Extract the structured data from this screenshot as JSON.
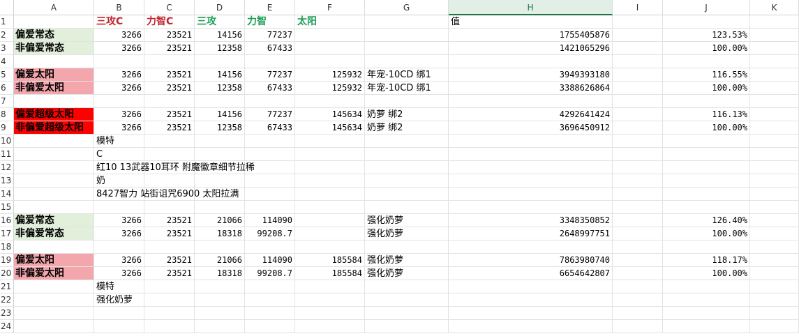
{
  "colors": {
    "green_fill": "#e2efda",
    "pink_fill": "#f4a6ad",
    "red_fill": "#ff0000",
    "header_red": "#c0262d",
    "header_green": "#1f9d55",
    "selected_col": "#217346"
  },
  "columns": [
    "A",
    "B",
    "C",
    "D",
    "E",
    "F",
    "G",
    "H",
    "I",
    "J",
    "K"
  ],
  "selected_column": "H",
  "rows": [
    "1",
    "2",
    "3",
    "4",
    "5",
    "6",
    "7",
    "8",
    "9",
    "10",
    "11",
    "12",
    "13",
    "14",
    "15",
    "16",
    "17",
    "18",
    "19",
    "20",
    "21",
    "22",
    "23",
    "24"
  ],
  "cells": [
    {
      "r": 1,
      "c": "B",
      "v": "三攻C",
      "style": "hdr-red"
    },
    {
      "r": 1,
      "c": "C",
      "v": "力智C",
      "style": "hdr-red"
    },
    {
      "r": 1,
      "c": "D",
      "v": "三攻",
      "style": "hdr-green"
    },
    {
      "r": 1,
      "c": "E",
      "v": "力智",
      "style": "hdr-green"
    },
    {
      "r": 1,
      "c": "F",
      "v": "太阳",
      "style": "hdr-green"
    },
    {
      "r": 1,
      "c": "H",
      "v": "值",
      "style": "txt"
    },
    {
      "r": 2,
      "c": "A",
      "v": "偏爱常态",
      "style": "lbl",
      "fill": "green_fill"
    },
    {
      "r": 2,
      "c": "B",
      "v": "3266",
      "style": "num"
    },
    {
      "r": 2,
      "c": "C",
      "v": "23521",
      "style": "num"
    },
    {
      "r": 2,
      "c": "D",
      "v": "14156",
      "style": "num"
    },
    {
      "r": 2,
      "c": "E",
      "v": "77237",
      "style": "num"
    },
    {
      "r": 2,
      "c": "H",
      "v": "1755405876",
      "style": "num"
    },
    {
      "r": 2,
      "c": "J",
      "v": "123.53%",
      "style": "num"
    },
    {
      "r": 3,
      "c": "A",
      "v": "非偏爱常态",
      "style": "lbl",
      "fill": "green_fill"
    },
    {
      "r": 3,
      "c": "B",
      "v": "3266",
      "style": "num"
    },
    {
      "r": 3,
      "c": "C",
      "v": "23521",
      "style": "num"
    },
    {
      "r": 3,
      "c": "D",
      "v": "12358",
      "style": "num"
    },
    {
      "r": 3,
      "c": "E",
      "v": "67433",
      "style": "num"
    },
    {
      "r": 3,
      "c": "H",
      "v": "1421065296",
      "style": "num"
    },
    {
      "r": 3,
      "c": "J",
      "v": "100.00%",
      "style": "num"
    },
    {
      "r": 5,
      "c": "A",
      "v": "偏爱太阳",
      "style": "lbl",
      "fill": "pink_fill"
    },
    {
      "r": 5,
      "c": "B",
      "v": "3266",
      "style": "num"
    },
    {
      "r": 5,
      "c": "C",
      "v": "23521",
      "style": "num"
    },
    {
      "r": 5,
      "c": "D",
      "v": "14156",
      "style": "num"
    },
    {
      "r": 5,
      "c": "E",
      "v": "77237",
      "style": "num"
    },
    {
      "r": 5,
      "c": "F",
      "v": "125932",
      "style": "num"
    },
    {
      "r": 5,
      "c": "G",
      "v": "年宠-10CD 绑1",
      "style": "txt"
    },
    {
      "r": 5,
      "c": "H",
      "v": "3949393180",
      "style": "num"
    },
    {
      "r": 5,
      "c": "J",
      "v": "116.55%",
      "style": "num"
    },
    {
      "r": 6,
      "c": "A",
      "v": "非偏爱太阳",
      "style": "lbl",
      "fill": "pink_fill"
    },
    {
      "r": 6,
      "c": "B",
      "v": "3266",
      "style": "num"
    },
    {
      "r": 6,
      "c": "C",
      "v": "23521",
      "style": "num"
    },
    {
      "r": 6,
      "c": "D",
      "v": "12358",
      "style": "num"
    },
    {
      "r": 6,
      "c": "E",
      "v": "67433",
      "style": "num"
    },
    {
      "r": 6,
      "c": "F",
      "v": "125932",
      "style": "num"
    },
    {
      "r": 6,
      "c": "G",
      "v": "年宠-10CD 绑1",
      "style": "txt"
    },
    {
      "r": 6,
      "c": "H",
      "v": "3388626864",
      "style": "num"
    },
    {
      "r": 6,
      "c": "J",
      "v": "100.00%",
      "style": "num"
    },
    {
      "r": 8,
      "c": "A",
      "v": "偏爱超级太阳",
      "style": "lbl",
      "fill": "red_fill"
    },
    {
      "r": 8,
      "c": "B",
      "v": "3266",
      "style": "num"
    },
    {
      "r": 8,
      "c": "C",
      "v": "23521",
      "style": "num"
    },
    {
      "r": 8,
      "c": "D",
      "v": "14156",
      "style": "num"
    },
    {
      "r": 8,
      "c": "E",
      "v": "77237",
      "style": "num"
    },
    {
      "r": 8,
      "c": "F",
      "v": "145634",
      "style": "num"
    },
    {
      "r": 8,
      "c": "G",
      "v": "奶萝 绑2",
      "style": "txt"
    },
    {
      "r": 8,
      "c": "H",
      "v": "4292641424",
      "style": "num"
    },
    {
      "r": 8,
      "c": "J",
      "v": "116.13%",
      "style": "num"
    },
    {
      "r": 9,
      "c": "A",
      "v": "非偏爱超级太阳",
      "style": "lbl",
      "fill": "red_fill"
    },
    {
      "r": 9,
      "c": "B",
      "v": "3266",
      "style": "num"
    },
    {
      "r": 9,
      "c": "C",
      "v": "23521",
      "style": "num"
    },
    {
      "r": 9,
      "c": "D",
      "v": "12358",
      "style": "num"
    },
    {
      "r": 9,
      "c": "E",
      "v": "67433",
      "style": "num"
    },
    {
      "r": 9,
      "c": "F",
      "v": "145634",
      "style": "num"
    },
    {
      "r": 9,
      "c": "G",
      "v": "奶萝 绑2",
      "style": "txt"
    },
    {
      "r": 9,
      "c": "H",
      "v": "3696450912",
      "style": "num"
    },
    {
      "r": 9,
      "c": "J",
      "v": "100.00%",
      "style": "num"
    },
    {
      "r": 10,
      "c": "B",
      "v": "模特",
      "style": "txt"
    },
    {
      "r": 11,
      "c": "B",
      "v": "C",
      "style": "txt"
    },
    {
      "r": 12,
      "c": "B",
      "v": "红10 13武器10耳环 附魔徽章细节拉稀",
      "style": "txt"
    },
    {
      "r": 13,
      "c": "B",
      "v": "奶",
      "style": "txt"
    },
    {
      "r": 14,
      "c": "B",
      "v": "8427智力 站街诅咒6900 太阳拉满",
      "style": "txt"
    },
    {
      "r": 16,
      "c": "A",
      "v": "偏爱常态",
      "style": "lbl",
      "fill": "green_fill"
    },
    {
      "r": 16,
      "c": "B",
      "v": "3266",
      "style": "num"
    },
    {
      "r": 16,
      "c": "C",
      "v": "23521",
      "style": "num"
    },
    {
      "r": 16,
      "c": "D",
      "v": "21066",
      "style": "num"
    },
    {
      "r": 16,
      "c": "E",
      "v": "114090",
      "style": "num"
    },
    {
      "r": 16,
      "c": "G",
      "v": "强化奶萝",
      "style": "txt"
    },
    {
      "r": 16,
      "c": "H",
      "v": "3348350852",
      "style": "num"
    },
    {
      "r": 16,
      "c": "J",
      "v": "126.40%",
      "style": "num"
    },
    {
      "r": 17,
      "c": "A",
      "v": "非偏爱常态",
      "style": "lbl",
      "fill": "green_fill"
    },
    {
      "r": 17,
      "c": "B",
      "v": "3266",
      "style": "num"
    },
    {
      "r": 17,
      "c": "C",
      "v": "23521",
      "style": "num"
    },
    {
      "r": 17,
      "c": "D",
      "v": "18318",
      "style": "num"
    },
    {
      "r": 17,
      "c": "E",
      "v": "99208.7",
      "style": "num"
    },
    {
      "r": 17,
      "c": "G",
      "v": "强化奶萝",
      "style": "txt"
    },
    {
      "r": 17,
      "c": "H",
      "v": "2648997751",
      "style": "num"
    },
    {
      "r": 17,
      "c": "J",
      "v": "100.00%",
      "style": "num"
    },
    {
      "r": 19,
      "c": "A",
      "v": "偏爱太阳",
      "style": "lbl",
      "fill": "pink_fill"
    },
    {
      "r": 19,
      "c": "B",
      "v": "3266",
      "style": "num"
    },
    {
      "r": 19,
      "c": "C",
      "v": "23521",
      "style": "num"
    },
    {
      "r": 19,
      "c": "D",
      "v": "21066",
      "style": "num"
    },
    {
      "r": 19,
      "c": "E",
      "v": "114090",
      "style": "num"
    },
    {
      "r": 19,
      "c": "F",
      "v": "185584",
      "style": "num"
    },
    {
      "r": 19,
      "c": "G",
      "v": "强化奶萝",
      "style": "txt"
    },
    {
      "r": 19,
      "c": "H",
      "v": "7863980740",
      "style": "num"
    },
    {
      "r": 19,
      "c": "J",
      "v": "118.17%",
      "style": "num"
    },
    {
      "r": 20,
      "c": "A",
      "v": "非偏爱太阳",
      "style": "lbl",
      "fill": "pink_fill"
    },
    {
      "r": 20,
      "c": "B",
      "v": "3266",
      "style": "num"
    },
    {
      "r": 20,
      "c": "C",
      "v": "23521",
      "style": "num"
    },
    {
      "r": 20,
      "c": "D",
      "v": "18318",
      "style": "num"
    },
    {
      "r": 20,
      "c": "E",
      "v": "99208.7",
      "style": "num"
    },
    {
      "r": 20,
      "c": "F",
      "v": "185584",
      "style": "num"
    },
    {
      "r": 20,
      "c": "G",
      "v": "强化奶萝",
      "style": "txt"
    },
    {
      "r": 20,
      "c": "H",
      "v": "6654642807",
      "style": "num"
    },
    {
      "r": 20,
      "c": "J",
      "v": "100.00%",
      "style": "num"
    },
    {
      "r": 21,
      "c": "B",
      "v": "模特",
      "style": "txt"
    },
    {
      "r": 22,
      "c": "B",
      "v": "强化奶萝",
      "style": "txt"
    }
  ]
}
